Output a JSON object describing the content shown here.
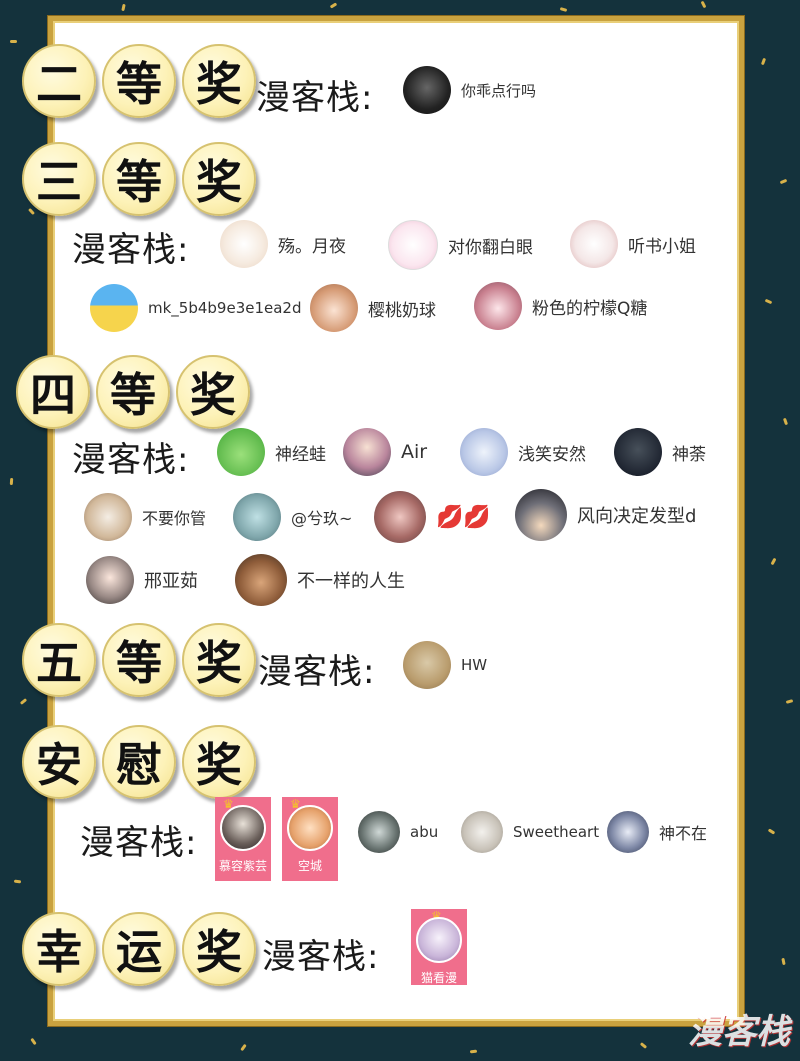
{
  "shop_label": "漫客栈:",
  "prizes": {
    "second": {
      "c1": "二",
      "c2": "等",
      "c3": "奖"
    },
    "third": {
      "c1": "三",
      "c2": "等",
      "c3": "奖"
    },
    "fourth": {
      "c1": "四",
      "c2": "等",
      "c3": "奖"
    },
    "fifth": {
      "c1": "五",
      "c2": "等",
      "c3": "奖"
    },
    "consolation": {
      "c1": "安",
      "c2": "慰",
      "c3": "奖"
    },
    "lucky": {
      "c1": "幸",
      "c2": "运",
      "c3": "奖"
    }
  },
  "winners": {
    "second": [
      "你乖点行吗"
    ],
    "third": [
      "殇。月夜",
      "对你翻白眼",
      "听书小姐",
      "mk_5b4b9e3e1ea2d",
      "樱桃奶球",
      "粉色的柠檬Q糖"
    ],
    "fourth": [
      "神经蛙",
      "Air",
      "浅笑安然",
      "神荼",
      "不要你管",
      "@兮玖~",
      "💋💋",
      "风向决定发型d",
      "邢亚茹",
      "不一样的人生"
    ],
    "fifth": [
      "HW"
    ],
    "consolation": [
      "慕容紫芸",
      "空城",
      "abu",
      "Sweetheart",
      "神不在"
    ],
    "lucky": [
      "猫看漫"
    ]
  },
  "watermark": "漫客栈",
  "colors": {
    "background": "#14323c",
    "frame_gold": "#c9a23f",
    "medal": "#fdf2b8",
    "card_pink": "#f06e8c"
  }
}
